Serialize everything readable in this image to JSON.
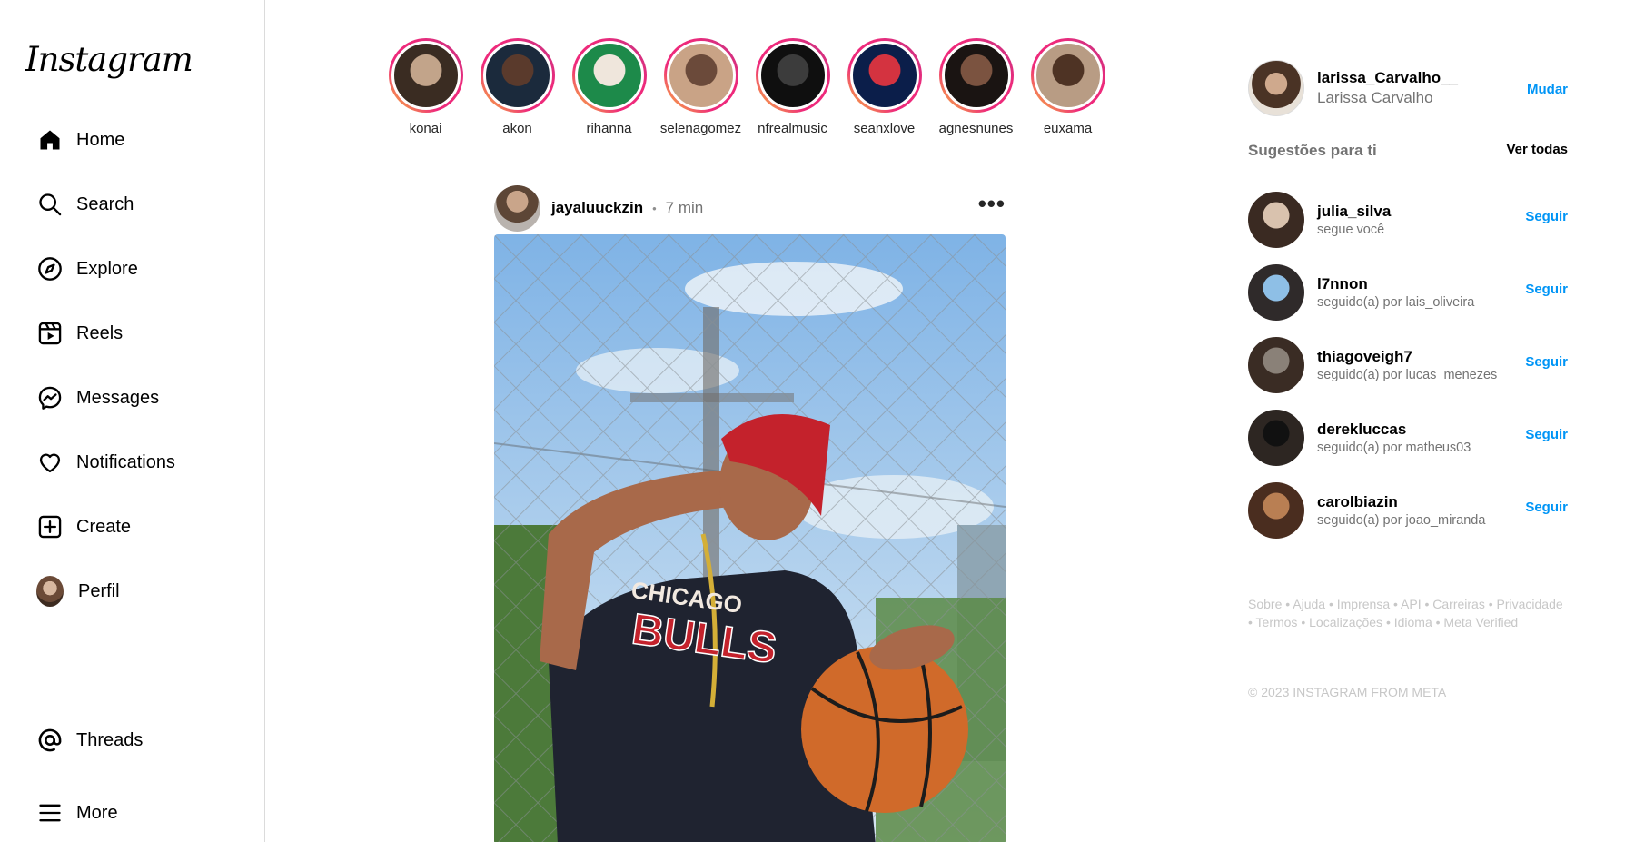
{
  "app": {
    "logo": "Instagram"
  },
  "sidebar": {
    "items": [
      {
        "label": "Home",
        "icon": "home-icon"
      },
      {
        "label": "Search",
        "icon": "search-icon"
      },
      {
        "label": "Explore",
        "icon": "compass-icon"
      },
      {
        "label": "Reels",
        "icon": "reels-icon"
      },
      {
        "label": "Messages",
        "icon": "messenger-icon"
      },
      {
        "label": "Notifications",
        "icon": "heart-icon"
      },
      {
        "label": "Create",
        "icon": "plus-square-icon"
      },
      {
        "label": "Perfil",
        "icon": "profile-avatar"
      }
    ],
    "bottom": [
      {
        "label": "Threads",
        "icon": "threads-icon"
      },
      {
        "label": "More",
        "icon": "hamburger-icon"
      }
    ]
  },
  "stories": [
    {
      "name": "konai",
      "colors": [
        "#3a2c22",
        "#c2a48a"
      ]
    },
    {
      "name": "akon",
      "colors": [
        "#1b2a3c",
        "#5a3a2c"
      ]
    },
    {
      "name": "rihanna",
      "colors": [
        "#1d8a4a",
        "#efe6dc"
      ]
    },
    {
      "name": "selenagomez",
      "colors": [
        "#c9a386",
        "#6b4a3a"
      ]
    },
    {
      "name": "nfrealmusic",
      "colors": [
        "#0f0f0f",
        "#3c3c3c"
      ]
    },
    {
      "name": "seanxlove",
      "colors": [
        "#0b1e4a",
        "#d43340"
      ]
    },
    {
      "name": "agnesnunes",
      "colors": [
        "#1a1412",
        "#7b5340"
      ]
    },
    {
      "name": "euxama",
      "colors": [
        "#b89c84",
        "#4e3324"
      ]
    }
  ],
  "post": {
    "username": "jayaluuckzin",
    "dot": "•",
    "time": "7 min",
    "more": "•••",
    "image": {
      "sky": "#9dc6ec",
      "shirt": "#1f2330",
      "cap": "#c4222c",
      "ball": "#d06a2a",
      "skin": "#a8694a",
      "print": "Chicago Bulls"
    }
  },
  "right": {
    "me": {
      "username": "larissa_Carvalho__",
      "name": "Larissa Carvalho",
      "action": "Mudar"
    },
    "suggestions_title": "Sugestões para ti",
    "see_all": "Ver todas",
    "suggestions": [
      {
        "username": "julia_silva",
        "subtitle": "segue você",
        "action": "Seguir",
        "colors": [
          "#d9c2ae",
          "#3a2a22"
        ]
      },
      {
        "username": "l7nnon",
        "subtitle": "seguido(a) por lais_oliveira",
        "action": "Seguir",
        "colors": [
          "#8ebfe6",
          "#2f2a2a"
        ]
      },
      {
        "username": "thiagoveigh7",
        "subtitle": "seguido(a) por lucas_menezes",
        "action": "Seguir",
        "colors": [
          "#8a8178",
          "#3a2c24"
        ]
      },
      {
        "username": "derekluccas",
        "subtitle": "seguido(a) por matheus03",
        "action": "Seguir",
        "colors": [
          "#111111",
          "#2d2622"
        ]
      },
      {
        "username": "carolbiazin",
        "subtitle": "seguido(a) por joao_miranda",
        "action": "Seguir",
        "colors": [
          "#b97f53",
          "#4a2d1f"
        ]
      }
    ],
    "footer": "Sobre • Ajuda • Imprensa • API • Carreiras • Privacidade • Termos • Localizações • Idioma • Meta Verified",
    "copyright": "© 2023 INSTAGRAM FROM META"
  }
}
